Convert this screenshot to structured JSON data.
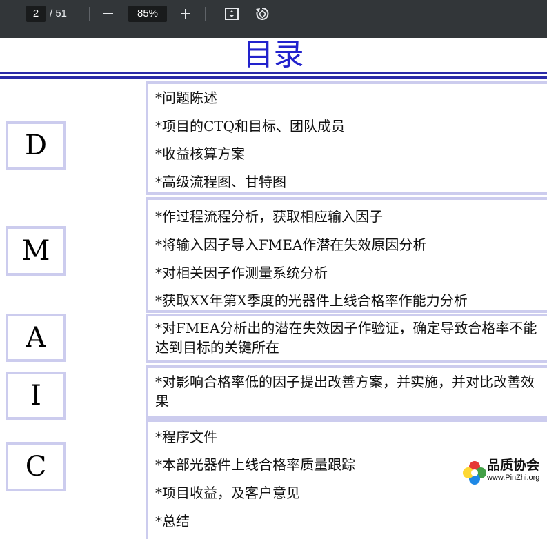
{
  "toolbar": {
    "page_current": "2",
    "page_total": "/ 51",
    "zoom": "85%",
    "icons": [
      "minus-icon",
      "plus-icon",
      "fit-page-icon",
      "rotate-icon"
    ]
  },
  "slide": {
    "title": "目录",
    "phases": [
      {
        "letter": "D",
        "items": [
          "*问题陈述",
          "*项目的CTQ和目标、团队成员",
          "*收益核算方案",
          "*高级流程图、甘特图"
        ]
      },
      {
        "letter": "M",
        "items": [
          "*作过程流程分析，获取相应输入因子",
          "*将输入因子导入FMEA作潜在失效原因分析",
          "*对相关因子作测量系统分析",
          "*获取XX年第X季度的光器件上线合格率作能力分析"
        ]
      },
      {
        "letter": "A",
        "items": [
          "*对FMEA分析出的潜在失效因子作验证，确定导致合格率不能达到目标的关键所在"
        ]
      },
      {
        "letter": "I",
        "items": [
          "*对影响合格率低的因子提出改善方案，并实施，并对比改善效果"
        ]
      },
      {
        "letter": "C",
        "items": [
          "*程序文件",
          "*本部光器件上线合格率质量跟踪",
          "*项目收益，及客户意见",
          "*总结"
        ]
      }
    ]
  },
  "watermark": {
    "name": "品质协会",
    "url": "www.PinZhi.org"
  },
  "colors": {
    "title": "#2222cc",
    "rule": "#2a2aa8",
    "box_border": "#ccccee",
    "toolbar": "#323639"
  }
}
